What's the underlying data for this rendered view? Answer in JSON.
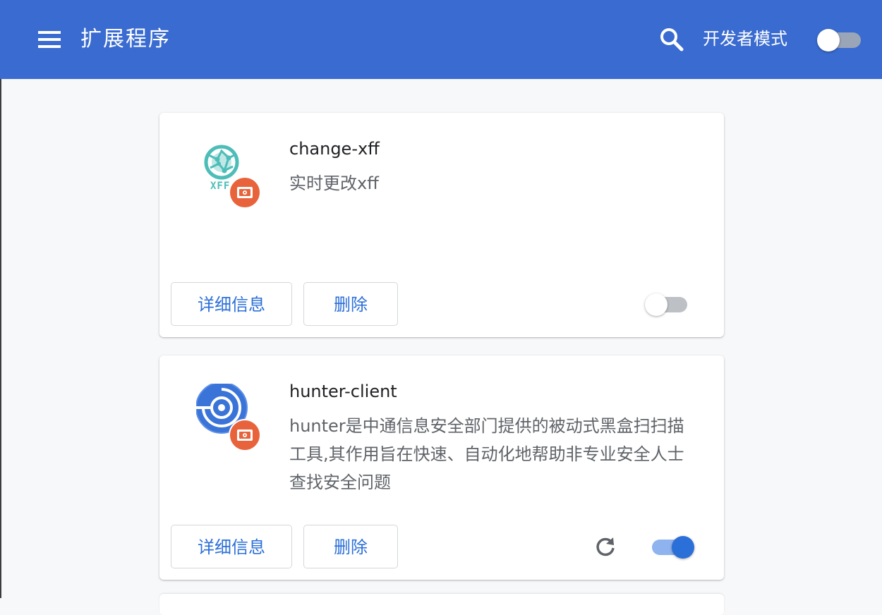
{
  "header": {
    "title": "扩展程序",
    "menu_icon": "menu-icon",
    "search_icon": "search-icon",
    "dev_mode_label": "开发者模式",
    "dev_mode_enabled": false,
    "background_color": "#3a6bd0"
  },
  "extensions": [
    {
      "name": "change-xff",
      "description": "实时更改xff",
      "icon": "globe-xff-icon",
      "icon_badge": "xff",
      "badge_icon": "unpacked-drive-icon",
      "details_label": "详细信息",
      "remove_label": "删除",
      "enabled": false
    },
    {
      "name": "hunter-client",
      "description": "hunter是中通信息安全部门提供的被动式黑盒扫扫描工具,其作用旨在快速、自动化地帮助非专业安全人士查找安全问题",
      "icon": "radar-target-icon",
      "badge_icon": "unpacked-drive-icon",
      "details_label": "详细信息",
      "remove_label": "删除",
      "reload_icon": "reload-icon",
      "enabled": true
    }
  ],
  "colors": {
    "accent": "#2b6fd8",
    "badge": "#e8633b",
    "page_background": "#f7f8fa"
  }
}
